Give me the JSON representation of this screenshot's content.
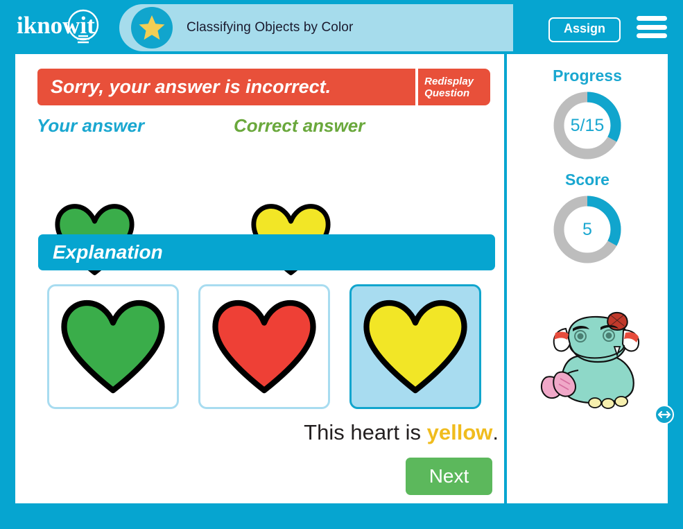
{
  "header": {
    "logo_text": "iknowit",
    "logo_icon": "lightbulb-icon",
    "star_icon": "star-icon",
    "title": "Classifying Objects by Color",
    "assign_label": "Assign",
    "menu_icon": "hamburger-menu-icon"
  },
  "result": {
    "message": "Sorry, your answer is incorrect.",
    "redisplay_line1": "Redisplay",
    "redisplay_line2": "Question",
    "banner_color": "#E8503A"
  },
  "answers": {
    "your_answer_label": "Your answer",
    "your_answer_color": "#3AAD4A",
    "your_answer_shape": "heart-icon",
    "correct_answer_label": "Correct answer",
    "correct_answer_color": "#F2E626",
    "correct_answer_shape": "heart-icon"
  },
  "explanation": {
    "heading": "Explanation",
    "options": [
      {
        "shape": "heart-icon",
        "color": "#3AAD4A",
        "selected": false
      },
      {
        "shape": "heart-icon",
        "color": "#EE4036",
        "selected": false
      },
      {
        "shape": "heart-icon",
        "color": "#F2E626",
        "selected": true
      }
    ],
    "sentence_prefix": "This heart is ",
    "sentence_highlight": "yellow",
    "sentence_suffix": ".",
    "highlight_color": "#F0BC1E"
  },
  "next_button": {
    "label": "Next",
    "color": "#5CB85C"
  },
  "sidebar": {
    "progress": {
      "label": "Progress",
      "value": "5/15",
      "percent": 33
    },
    "score": {
      "label": "Score",
      "value": "5",
      "percent": 33
    },
    "track_color": "#BDBDBD",
    "arc_color": "#11A5CD",
    "mascot_icon": "monster-mascot-icon",
    "resize_icon": "resize-horizontal-icon"
  }
}
